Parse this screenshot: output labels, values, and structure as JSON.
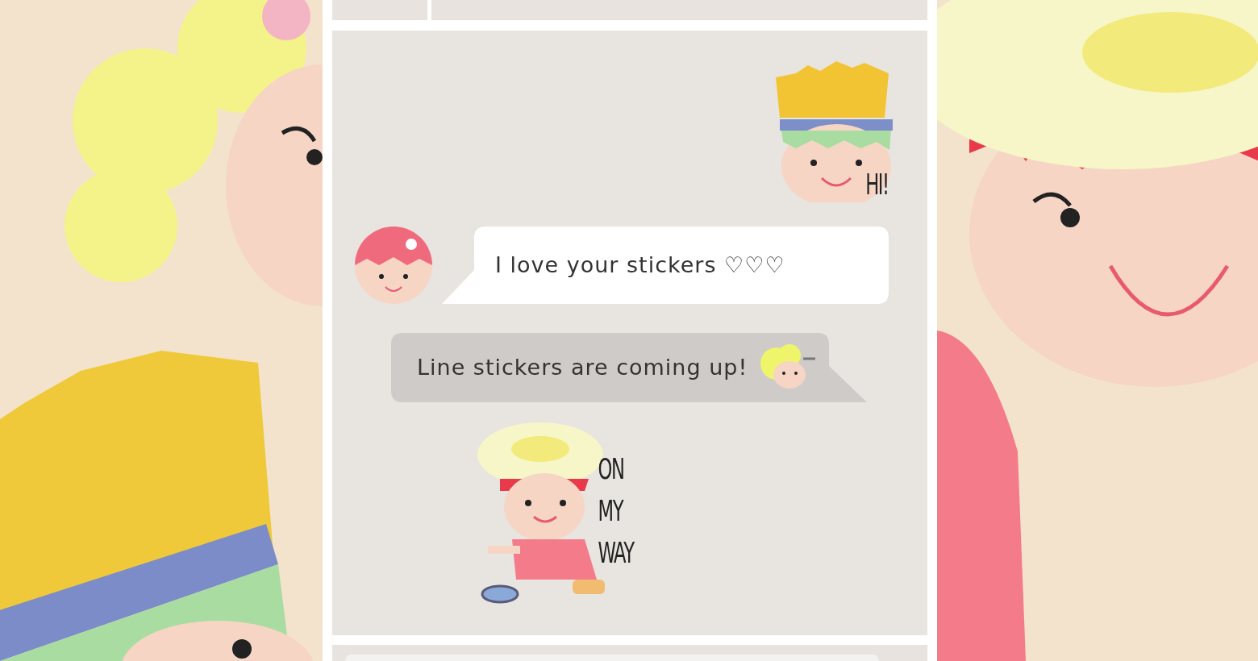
{
  "messages": [
    {
      "kind": "fries",
      "outgoing": true,
      "caption": [
        "HI!"
      ]
    },
    {
      "kind": "text",
      "outgoing": false,
      "avatar": true,
      "inline_sticker": false,
      "text": "I love your stickers ♡♡♡"
    },
    {
      "kind": "text",
      "outgoing": true,
      "avatar": false,
      "inline_sticker": true,
      "text": "Line stickers are coming up!"
    },
    {
      "kind": "egg",
      "outgoing": false,
      "caption": [
        "ON",
        "MY",
        "WAY"
      ]
    }
  ]
}
